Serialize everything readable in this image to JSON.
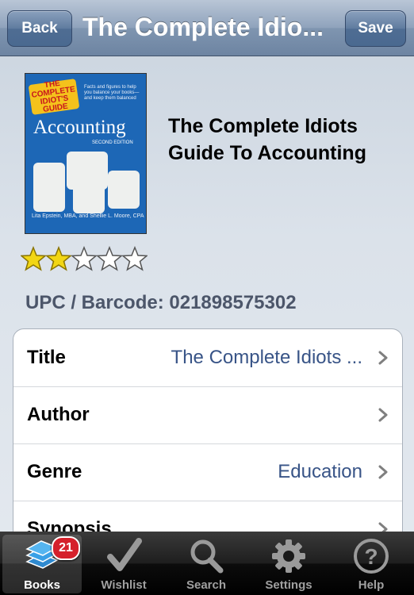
{
  "navbar": {
    "back_label": "Back",
    "title": "The Complete Idio...",
    "save_label": "Save"
  },
  "book": {
    "cover": {
      "series": "THE COMPLETE IDIOT'S GUIDE",
      "blurb": "Facts and figures to help you balance your books—and keep them balanced",
      "title": "Accounting",
      "edition": "SECOND EDITION",
      "author": "Lita Epstein, MBA, and Shellie L. Moore, CPA"
    },
    "title": "The Complete Idiots Guide To Accounting",
    "rating": 2,
    "rating_max": 5,
    "upc": "UPC / Barcode: 021898575302"
  },
  "details": [
    {
      "label": "Title",
      "value": "The Complete Idiots ..."
    },
    {
      "label": "Author",
      "value": ""
    },
    {
      "label": "Genre",
      "value": "Education"
    },
    {
      "label": "Synopsis",
      "value": ""
    }
  ],
  "tabs": [
    {
      "label": "Books",
      "icon": "books-icon",
      "badge": "21",
      "active": true
    },
    {
      "label": "Wishlist",
      "icon": "checkmark-icon"
    },
    {
      "label": "Search",
      "icon": "magnifier-icon"
    },
    {
      "label": "Settings",
      "icon": "gear-icon"
    },
    {
      "label": "Help",
      "icon": "help-icon"
    }
  ],
  "colors": {
    "star_filled": "#f2d614",
    "value_text": "#385487",
    "badge": "#d5202b"
  }
}
